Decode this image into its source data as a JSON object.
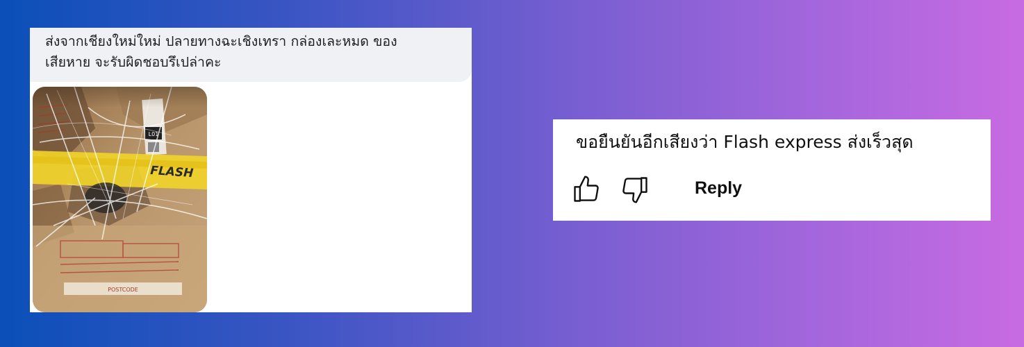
{
  "facebook_comment": {
    "text_line1": "ส่งจากเชียงใหม่ใหม่ ปลายทางฉะเชิงเทรา กล่องเละหมด ของ",
    "text_line2": "เสียหาย จะรับผิดชอบรึเปล่าคะ",
    "photo": {
      "tape_text": "FLASH",
      "sticker_code": "L01",
      "postcode_label": "POSTCODE",
      "colors": {
        "cardboard": "#b8946a",
        "tape": "#f0d22a"
      }
    }
  },
  "youtube_comment": {
    "text": "ขอยืนยันอีกเสียงว่า Flash express ส่งเร็วสุด",
    "like_icon": "thumbs-up-icon",
    "dislike_icon": "thumbs-down-icon",
    "reply_label": "Reply"
  },
  "background": {
    "gradient_start": "#0b4fb8",
    "gradient_end": "#c86be2"
  }
}
